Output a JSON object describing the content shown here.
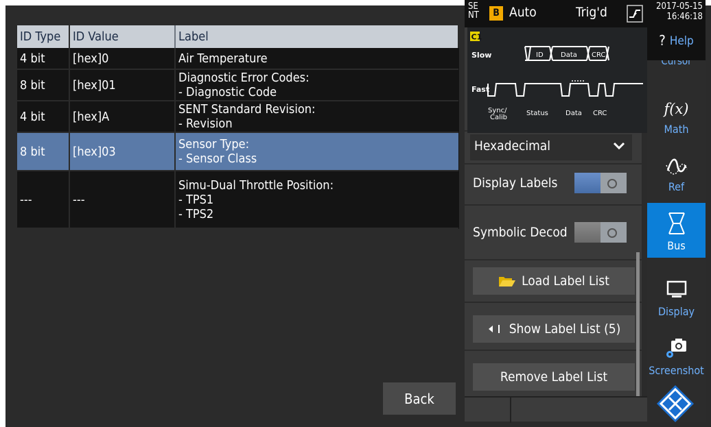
{
  "status": {
    "bus_abbrev": "SE NT",
    "bus_badge": "B",
    "trigger_mode": "Auto",
    "trigger_status": "Trig'd",
    "date": "2017-05-15",
    "time": "16:46:18"
  },
  "table": {
    "headers": [
      "ID Type",
      "ID Value",
      "Label"
    ],
    "rows": [
      {
        "id_type": "4 bit",
        "id_value": "[hex]0",
        "label": "Air Temperature",
        "selected": false
      },
      {
        "id_type": "8 bit",
        "id_value": "[hex]01",
        "label": "Diagnostic Error Codes:\n- Diagnostic Code",
        "selected": false
      },
      {
        "id_type": "4 bit",
        "id_value": "[hex]A",
        "label": "SENT Standard Revision:\n- Revision",
        "selected": false
      },
      {
        "id_type": "8 bit",
        "id_value": "[hex]03",
        "label": "Sensor Type:\n- Sensor Class",
        "selected": true
      },
      {
        "id_type": "---",
        "id_value": "---",
        "label": "Simu-Dual Throttle Position:\n- TPS1\n- TPS2",
        "selected": false
      }
    ]
  },
  "back_label": "Back",
  "protocol_diagram": {
    "channel": "C1",
    "slow_label": "Slow",
    "fast_label": "Fast",
    "slow_fields": [
      "ID",
      "Data",
      "CRC"
    ],
    "fast_fields": [
      "Sync/\nCalib",
      "Status",
      "Data",
      "CRC"
    ]
  },
  "menu": {
    "format_value": "Hexadecimal",
    "display_labels": {
      "label": "Display Labels",
      "on": true
    },
    "symbolic_decode": {
      "label": "Symbolic Decod",
      "on": false
    },
    "load_label_list": "Load Label List",
    "show_label_list": "Show Label List (5)",
    "remove_label_list": "Remove Label List"
  },
  "sidebar": {
    "help": "Help",
    "cursor_partial": "Cursor",
    "math": "Math",
    "ref": "Ref",
    "bus": "Bus",
    "display": "Display",
    "screenshot": "Screenshot"
  },
  "colors": {
    "accent_blue": "#0c7fd8",
    "selected_row": "#5a7aa8",
    "sidebar_text": "#6fb2ff",
    "badge": "#f2a900"
  }
}
